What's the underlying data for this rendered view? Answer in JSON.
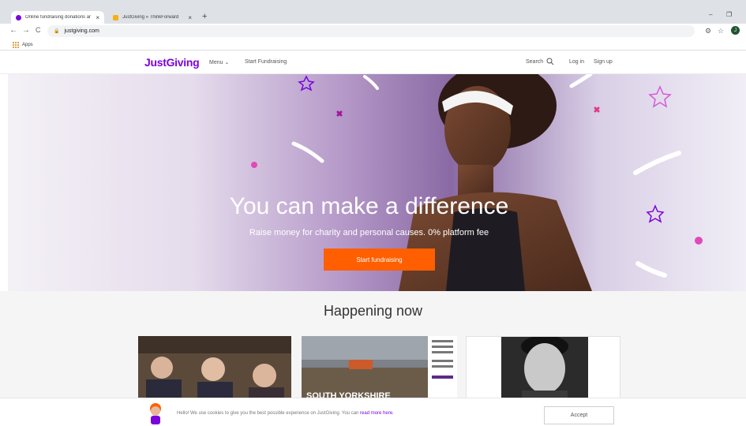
{
  "browser": {
    "tabs": [
      {
        "title": "Online fundraising donations an",
        "close": "×",
        "favicon_color": "#7a04dd"
      },
      {
        "title": "JustGiving » ThinkForward",
        "close": "×",
        "favicon_color": "#f6b012"
      }
    ],
    "new_tab": "+",
    "window_controls": {
      "minimize": "–",
      "restore": "❐"
    },
    "nav": {
      "back": "←",
      "forward": "→",
      "reload": "C"
    },
    "url": "justgiving.com",
    "bookmarks": {
      "apps_label": "Apps"
    },
    "profile_initial": "J"
  },
  "site": {
    "logo": "JustGiving",
    "nav": {
      "menu": "Menu",
      "start_fundraising": "Start Fundraising",
      "search": "Search",
      "login": "Log in",
      "signup": "Sign up"
    },
    "hero": {
      "title": "You can make a difference",
      "subtitle": "Raise money for charity and personal causes. 0% platform fee",
      "cta": "Start fundraising"
    },
    "happening": {
      "title": "Happening now",
      "cards": [
        {
          "caption": ""
        },
        {
          "caption": "SOUTH YORKSHIRE"
        },
        {
          "caption": ""
        }
      ]
    },
    "cookie": {
      "text": "Hello! We use cookies to give you the best possible experience on JustGiving. You can ",
      "link": "read more here.",
      "accept": "Accept"
    }
  },
  "colors": {
    "brand": "#7a04dd",
    "cta": "#ff5f00"
  }
}
